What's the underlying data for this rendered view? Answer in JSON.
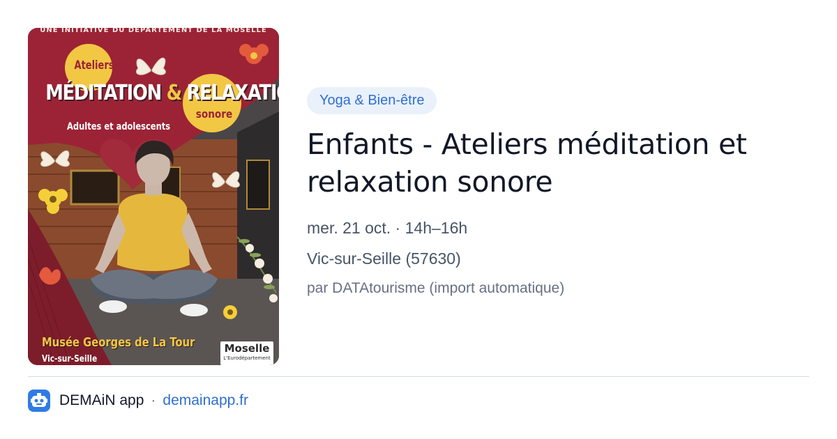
{
  "event": {
    "category": "Yoga & Bien-être",
    "title": "Enfants - Ateliers méditation et relaxation sonore",
    "date": "mer. 21 oct. · 14h–16h",
    "location": "Vic-sur-Seille (57630)",
    "source": "par DATAtourisme (import automatique)"
  },
  "poster": {
    "initiative": "UNE INITIATIVE DU DÉPARTEMENT DE LA MOSELLE",
    "ateliers": "Ateliers",
    "title_left": "MÉDITATION",
    "title_amp": "&",
    "title_right": "RELAXATION",
    "sonore": "sonore",
    "audience": "Adultes et adolescents",
    "museum": "Musée Georges de La Tour",
    "town": "Vic-sur-Seille",
    "logo_main": "Moselle",
    "logo_sub": "L'Eurodépartement"
  },
  "footer": {
    "app_name": "DEMAiN app",
    "separator": "·",
    "domain": "demainapp.fr",
    "logo_icon": "robot-face-icon"
  },
  "colors": {
    "tag_bg": "#eaf1fb",
    "accent": "#2f6fd0",
    "poster_crimson": "#9b2335",
    "poster_yellow": "#f2c744"
  }
}
